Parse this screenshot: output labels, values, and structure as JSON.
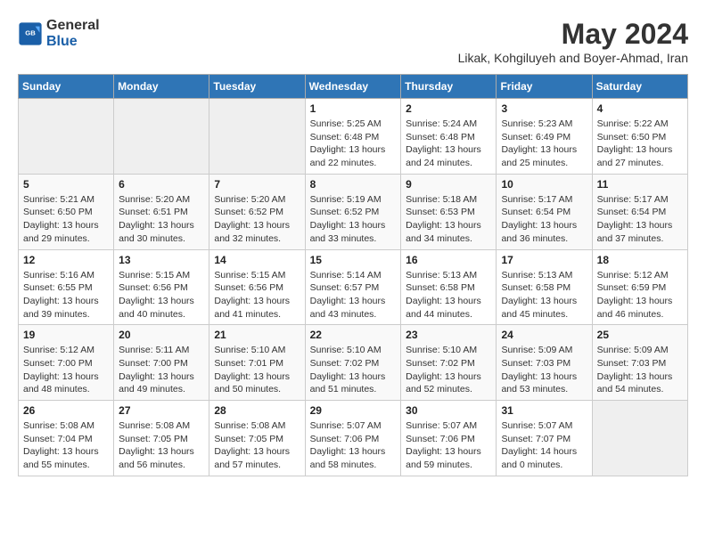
{
  "header": {
    "logo_line1": "General",
    "logo_line2": "Blue",
    "title": "May 2024",
    "location": "Likak, Kohgiluyeh and Boyer-Ahmad, Iran"
  },
  "days_of_week": [
    "Sunday",
    "Monday",
    "Tuesday",
    "Wednesday",
    "Thursday",
    "Friday",
    "Saturday"
  ],
  "weeks": [
    [
      {
        "num": "",
        "info": ""
      },
      {
        "num": "",
        "info": ""
      },
      {
        "num": "",
        "info": ""
      },
      {
        "num": "1",
        "info": "Sunrise: 5:25 AM\nSunset: 6:48 PM\nDaylight: 13 hours and 22 minutes."
      },
      {
        "num": "2",
        "info": "Sunrise: 5:24 AM\nSunset: 6:48 PM\nDaylight: 13 hours and 24 minutes."
      },
      {
        "num": "3",
        "info": "Sunrise: 5:23 AM\nSunset: 6:49 PM\nDaylight: 13 hours and 25 minutes."
      },
      {
        "num": "4",
        "info": "Sunrise: 5:22 AM\nSunset: 6:50 PM\nDaylight: 13 hours and 27 minutes."
      }
    ],
    [
      {
        "num": "5",
        "info": "Sunrise: 5:21 AM\nSunset: 6:50 PM\nDaylight: 13 hours and 29 minutes."
      },
      {
        "num": "6",
        "info": "Sunrise: 5:20 AM\nSunset: 6:51 PM\nDaylight: 13 hours and 30 minutes."
      },
      {
        "num": "7",
        "info": "Sunrise: 5:20 AM\nSunset: 6:52 PM\nDaylight: 13 hours and 32 minutes."
      },
      {
        "num": "8",
        "info": "Sunrise: 5:19 AM\nSunset: 6:52 PM\nDaylight: 13 hours and 33 minutes."
      },
      {
        "num": "9",
        "info": "Sunrise: 5:18 AM\nSunset: 6:53 PM\nDaylight: 13 hours and 34 minutes."
      },
      {
        "num": "10",
        "info": "Sunrise: 5:17 AM\nSunset: 6:54 PM\nDaylight: 13 hours and 36 minutes."
      },
      {
        "num": "11",
        "info": "Sunrise: 5:17 AM\nSunset: 6:54 PM\nDaylight: 13 hours and 37 minutes."
      }
    ],
    [
      {
        "num": "12",
        "info": "Sunrise: 5:16 AM\nSunset: 6:55 PM\nDaylight: 13 hours and 39 minutes."
      },
      {
        "num": "13",
        "info": "Sunrise: 5:15 AM\nSunset: 6:56 PM\nDaylight: 13 hours and 40 minutes."
      },
      {
        "num": "14",
        "info": "Sunrise: 5:15 AM\nSunset: 6:56 PM\nDaylight: 13 hours and 41 minutes."
      },
      {
        "num": "15",
        "info": "Sunrise: 5:14 AM\nSunset: 6:57 PM\nDaylight: 13 hours and 43 minutes."
      },
      {
        "num": "16",
        "info": "Sunrise: 5:13 AM\nSunset: 6:58 PM\nDaylight: 13 hours and 44 minutes."
      },
      {
        "num": "17",
        "info": "Sunrise: 5:13 AM\nSunset: 6:58 PM\nDaylight: 13 hours and 45 minutes."
      },
      {
        "num": "18",
        "info": "Sunrise: 5:12 AM\nSunset: 6:59 PM\nDaylight: 13 hours and 46 minutes."
      }
    ],
    [
      {
        "num": "19",
        "info": "Sunrise: 5:12 AM\nSunset: 7:00 PM\nDaylight: 13 hours and 48 minutes."
      },
      {
        "num": "20",
        "info": "Sunrise: 5:11 AM\nSunset: 7:00 PM\nDaylight: 13 hours and 49 minutes."
      },
      {
        "num": "21",
        "info": "Sunrise: 5:10 AM\nSunset: 7:01 PM\nDaylight: 13 hours and 50 minutes."
      },
      {
        "num": "22",
        "info": "Sunrise: 5:10 AM\nSunset: 7:02 PM\nDaylight: 13 hours and 51 minutes."
      },
      {
        "num": "23",
        "info": "Sunrise: 5:10 AM\nSunset: 7:02 PM\nDaylight: 13 hours and 52 minutes."
      },
      {
        "num": "24",
        "info": "Sunrise: 5:09 AM\nSunset: 7:03 PM\nDaylight: 13 hours and 53 minutes."
      },
      {
        "num": "25",
        "info": "Sunrise: 5:09 AM\nSunset: 7:03 PM\nDaylight: 13 hours and 54 minutes."
      }
    ],
    [
      {
        "num": "26",
        "info": "Sunrise: 5:08 AM\nSunset: 7:04 PM\nDaylight: 13 hours and 55 minutes."
      },
      {
        "num": "27",
        "info": "Sunrise: 5:08 AM\nSunset: 7:05 PM\nDaylight: 13 hours and 56 minutes."
      },
      {
        "num": "28",
        "info": "Sunrise: 5:08 AM\nSunset: 7:05 PM\nDaylight: 13 hours and 57 minutes."
      },
      {
        "num": "29",
        "info": "Sunrise: 5:07 AM\nSunset: 7:06 PM\nDaylight: 13 hours and 58 minutes."
      },
      {
        "num": "30",
        "info": "Sunrise: 5:07 AM\nSunset: 7:06 PM\nDaylight: 13 hours and 59 minutes."
      },
      {
        "num": "31",
        "info": "Sunrise: 5:07 AM\nSunset: 7:07 PM\nDaylight: 14 hours and 0 minutes."
      },
      {
        "num": "",
        "info": ""
      }
    ]
  ]
}
